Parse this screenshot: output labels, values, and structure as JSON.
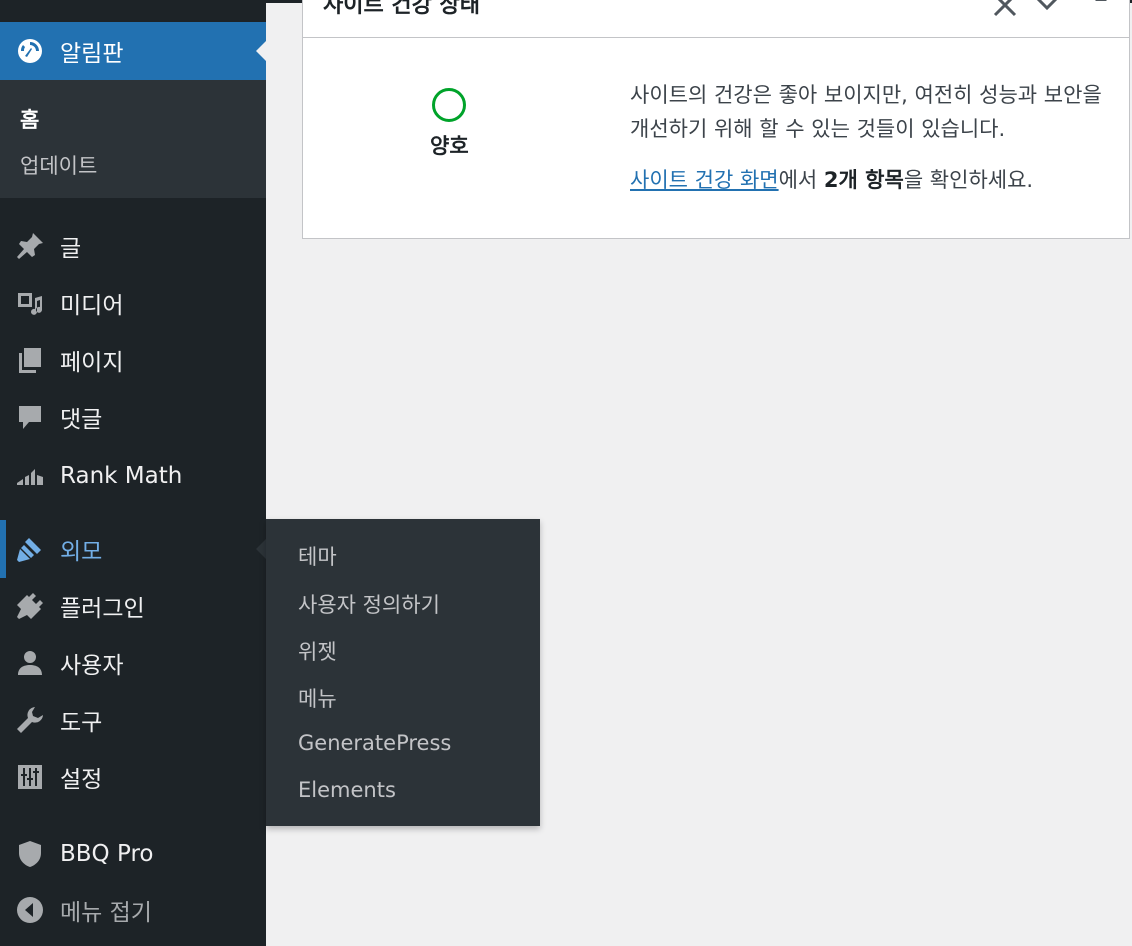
{
  "sidebar": {
    "dashboard": {
      "label": "알림판",
      "subitems": [
        "홈",
        "업데이트"
      ]
    },
    "items": [
      {
        "key": "posts",
        "label": "글",
        "icon": "pin-icon"
      },
      {
        "key": "media",
        "label": "미디어",
        "icon": "media-icon"
      },
      {
        "key": "pages",
        "label": "페이지",
        "icon": "pages-icon"
      },
      {
        "key": "comments",
        "label": "댓글",
        "icon": "comment-icon"
      },
      {
        "key": "rankmath",
        "label": "Rank Math",
        "icon": "rank-math-icon"
      },
      {
        "key": "appearance",
        "label": "외모",
        "icon": "brush-icon"
      },
      {
        "key": "plugins",
        "label": "플러그인",
        "icon": "plugin-icon"
      },
      {
        "key": "users",
        "label": "사용자",
        "icon": "user-icon"
      },
      {
        "key": "tools",
        "label": "도구",
        "icon": "wrench-icon"
      },
      {
        "key": "settings",
        "label": "설정",
        "icon": "sliders-icon"
      },
      {
        "key": "bbq",
        "label": "BBQ Pro",
        "icon": "shield-icon"
      },
      {
        "key": "collapse",
        "label": "메뉴 접기",
        "icon": "collapse-icon"
      }
    ],
    "appearance_flyout": [
      "테마",
      "사용자 정의하기",
      "위젯",
      "메뉴",
      "GeneratePress",
      "Elements"
    ]
  },
  "site_health": {
    "title": "사이트 건강 상태",
    "status": "양호",
    "description": "사이트의 건강은 좋아 보이지만, 여전히 성능과 보안을 개선하기 위해 할 수 있는 것들이 있습니다.",
    "link_text": "사이트 건강 화면",
    "text_mid": "에서 ",
    "count_text": "2개 항목",
    "text_end": "을 확인하세요.",
    "status_color": "#00a32a"
  },
  "colors": {
    "accent": "#2271b1",
    "sidebar_bg": "#1d2327",
    "submenu_bg": "#2c3338",
    "link_active": "#72aee6"
  }
}
